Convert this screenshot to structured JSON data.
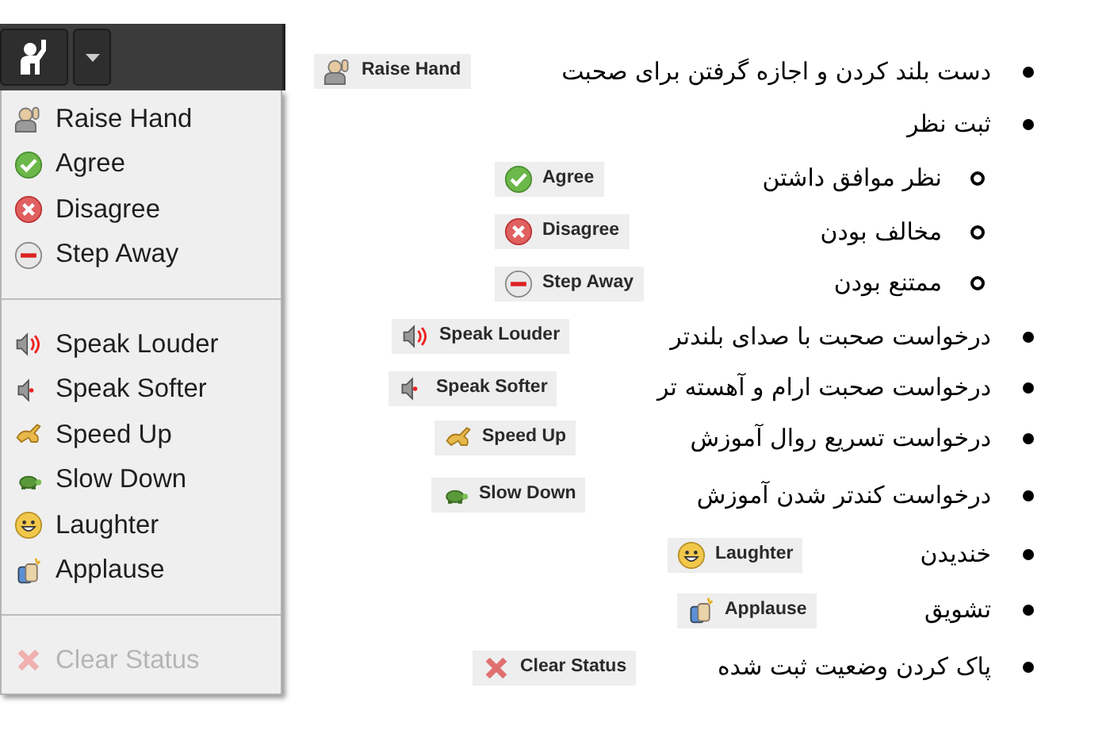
{
  "menu": {
    "sections": [
      {
        "items": [
          {
            "label": "Raise Hand",
            "disabled": false
          },
          {
            "label": "Agree",
            "disabled": false
          },
          {
            "label": "Disagree",
            "disabled": false
          },
          {
            "label": "Step Away",
            "disabled": false
          }
        ]
      },
      {
        "items": [
          {
            "label": "Speak Louder",
            "disabled": false
          },
          {
            "label": "Speak Softer",
            "disabled": false
          },
          {
            "label": "Speed Up",
            "disabled": false
          },
          {
            "label": "Slow Down",
            "disabled": false
          },
          {
            "label": "Laughter",
            "disabled": false
          },
          {
            "label": "Applause",
            "disabled": false
          }
        ]
      },
      {
        "items": [
          {
            "label": "Clear Status",
            "disabled": true
          }
        ]
      }
    ]
  },
  "list": [
    {
      "text": "دست بلند کردن و اجازه گرفتن برای صحبت",
      "chip": "Raise Hand"
    },
    {
      "text": "ثبت نظر",
      "children": [
        {
          "text": "نظر موافق داشتن",
          "chip": "Agree"
        },
        {
          "text": "مخالف بودن",
          "chip": "Disagree"
        },
        {
          "text": "ممتنع بودن",
          "chip": "Step Away"
        }
      ]
    },
    {
      "text": "درخواست صحبت با صدای بلندتر",
      "chip": "Speak Louder"
    },
    {
      "text": "درخواست صحبت ارام و آهسته تر",
      "chip": "Speak Softer"
    },
    {
      "text": "درخواست تسریع روال آموزش",
      "chip": "Speed Up"
    },
    {
      "text": "درخواست کندتر شدن آموزش",
      "chip": "Slow Down"
    },
    {
      "text": "خندیدن",
      "chip": "Laughter"
    },
    {
      "text": "تشویق",
      "chip": "Applause"
    },
    {
      "text": "پاک کردن وضعیت ثبت شده",
      "chip": "Clear Status"
    }
  ]
}
